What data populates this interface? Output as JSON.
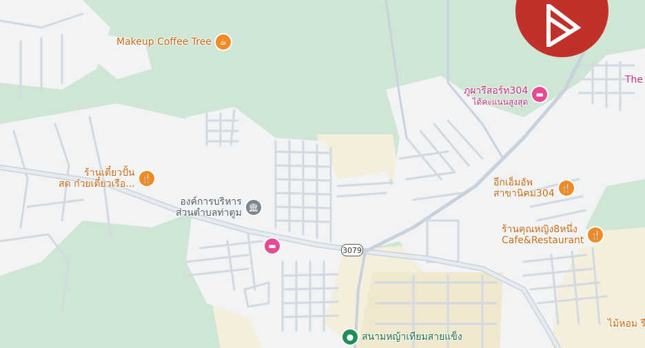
{
  "colors": {
    "forest": "#cfe6d4",
    "urban": "#f1f3f4",
    "sand": "#f4efdc",
    "road": "#c9d2dc",
    "logo": "#c2302b"
  },
  "pois": {
    "makeup_coffee": {
      "name": "Makeup Coffee Tree",
      "icon": "coffee-icon"
    },
    "phupha_resort": {
      "name": "ภูผารีสอร์ท304",
      "subtitle": "ได้คะแนนสูงสุด",
      "icon": "hotel-icon"
    },
    "the_partial": {
      "name": "The"
    },
    "noodle_shop": {
      "line1": "ร้านเตี๋ยวปั้น",
      "line2": "สด ก๋วยเตี๋ยวเรือ...",
      "icon": "restaurant-icon"
    },
    "sao_office": {
      "line1": "องค์การบริหาร",
      "line2": "ส่วนตำบลท่าตูม",
      "icon": "government-icon"
    },
    "hotel_unnamed": {
      "icon": "hotel-icon"
    },
    "ekamai": {
      "line1": "อีกเอ็มอัพ",
      "line2": "สาขานิคม304",
      "icon": "restaurant-icon"
    },
    "khun_ying": {
      "line1": "ร้านคุณหญิง8หนึ่ง",
      "line2": "Cafe&Restaurant",
      "icon": "restaurant-icon"
    },
    "football_field": {
      "name": "สนามหญ้าเทียมสายแข็ง",
      "icon": "park-icon"
    },
    "mai_hom": {
      "name": "ไม้หอม รี"
    }
  },
  "road_shield": "3079",
  "logo": {
    "icon": "brand-logo-icon"
  }
}
